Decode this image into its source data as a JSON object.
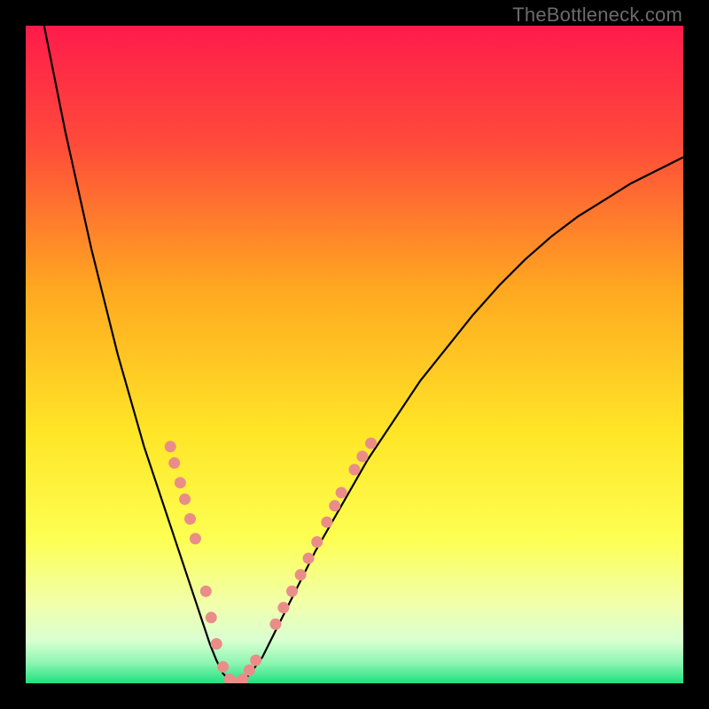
{
  "watermark": "TheBottleneck.com",
  "chart_data": {
    "type": "line",
    "title": "",
    "xlabel": "",
    "ylabel": "",
    "xlim": [
      0,
      100
    ],
    "ylim": [
      0,
      100
    ],
    "grid": false,
    "background": {
      "kind": "vertical-gradient",
      "stops": [
        {
          "pos": 0.0,
          "color": "#ff1b4b"
        },
        {
          "pos": 0.18,
          "color": "#ff4b3a"
        },
        {
          "pos": 0.4,
          "color": "#ffa820"
        },
        {
          "pos": 0.62,
          "color": "#ffe627"
        },
        {
          "pos": 0.78,
          "color": "#fdff52"
        },
        {
          "pos": 0.88,
          "color": "#f1ffac"
        },
        {
          "pos": 0.935,
          "color": "#d9ffd1"
        },
        {
          "pos": 0.97,
          "color": "#8bf5b1"
        },
        {
          "pos": 1.0,
          "color": "#1ee07f"
        }
      ]
    },
    "series": [
      {
        "name": "curve",
        "stroke": "#000000",
        "stroke_width": 2.2,
        "x": [
          0,
          2,
          4,
          6,
          8,
          10,
          12,
          14,
          16,
          18,
          20,
          22,
          24,
          26,
          27,
          28,
          29,
          30,
          31,
          32,
          33,
          34,
          36,
          38,
          40,
          44,
          48,
          52,
          56,
          60,
          64,
          68,
          72,
          76,
          80,
          84,
          88,
          92,
          96,
          100
        ],
        "y": [
          114,
          104,
          94,
          84,
          75,
          66,
          58,
          50,
          43,
          36,
          30,
          24,
          18,
          12,
          9,
          6,
          3.5,
          1.5,
          0.4,
          0,
          0.4,
          1.3,
          4,
          8,
          12,
          20,
          27,
          34,
          40,
          46,
          51,
          56,
          60.5,
          64.5,
          68,
          71,
          73.5,
          76,
          78,
          80
        ]
      }
    ],
    "markers": {
      "color": "#ea8d89",
      "radius": 6.5,
      "points": [
        {
          "x": 22.0,
          "y": 36.0
        },
        {
          "x": 22.6,
          "y": 33.5
        },
        {
          "x": 23.5,
          "y": 30.5
        },
        {
          "x": 24.2,
          "y": 28.0
        },
        {
          "x": 25.0,
          "y": 25.0
        },
        {
          "x": 25.8,
          "y": 22.0
        },
        {
          "x": 27.4,
          "y": 14.0
        },
        {
          "x": 28.2,
          "y": 10.0
        },
        {
          "x": 29.0,
          "y": 6.0
        },
        {
          "x": 30.0,
          "y": 2.5
        },
        {
          "x": 31.0,
          "y": 0.6
        },
        {
          "x": 32.0,
          "y": 0.0
        },
        {
          "x": 33.0,
          "y": 0.6
        },
        {
          "x": 34.0,
          "y": 2.0
        },
        {
          "x": 35.0,
          "y": 3.5
        },
        {
          "x": 38.0,
          "y": 9.0
        },
        {
          "x": 39.2,
          "y": 11.5
        },
        {
          "x": 40.5,
          "y": 14.0
        },
        {
          "x": 41.8,
          "y": 16.5
        },
        {
          "x": 43.0,
          "y": 19.0
        },
        {
          "x": 44.3,
          "y": 21.5
        },
        {
          "x": 45.8,
          "y": 24.5
        },
        {
          "x": 47.0,
          "y": 27.0
        },
        {
          "x": 48.0,
          "y": 29.0
        },
        {
          "x": 50.0,
          "y": 32.5
        },
        {
          "x": 51.2,
          "y": 34.5
        },
        {
          "x": 52.5,
          "y": 36.5
        }
      ]
    }
  }
}
